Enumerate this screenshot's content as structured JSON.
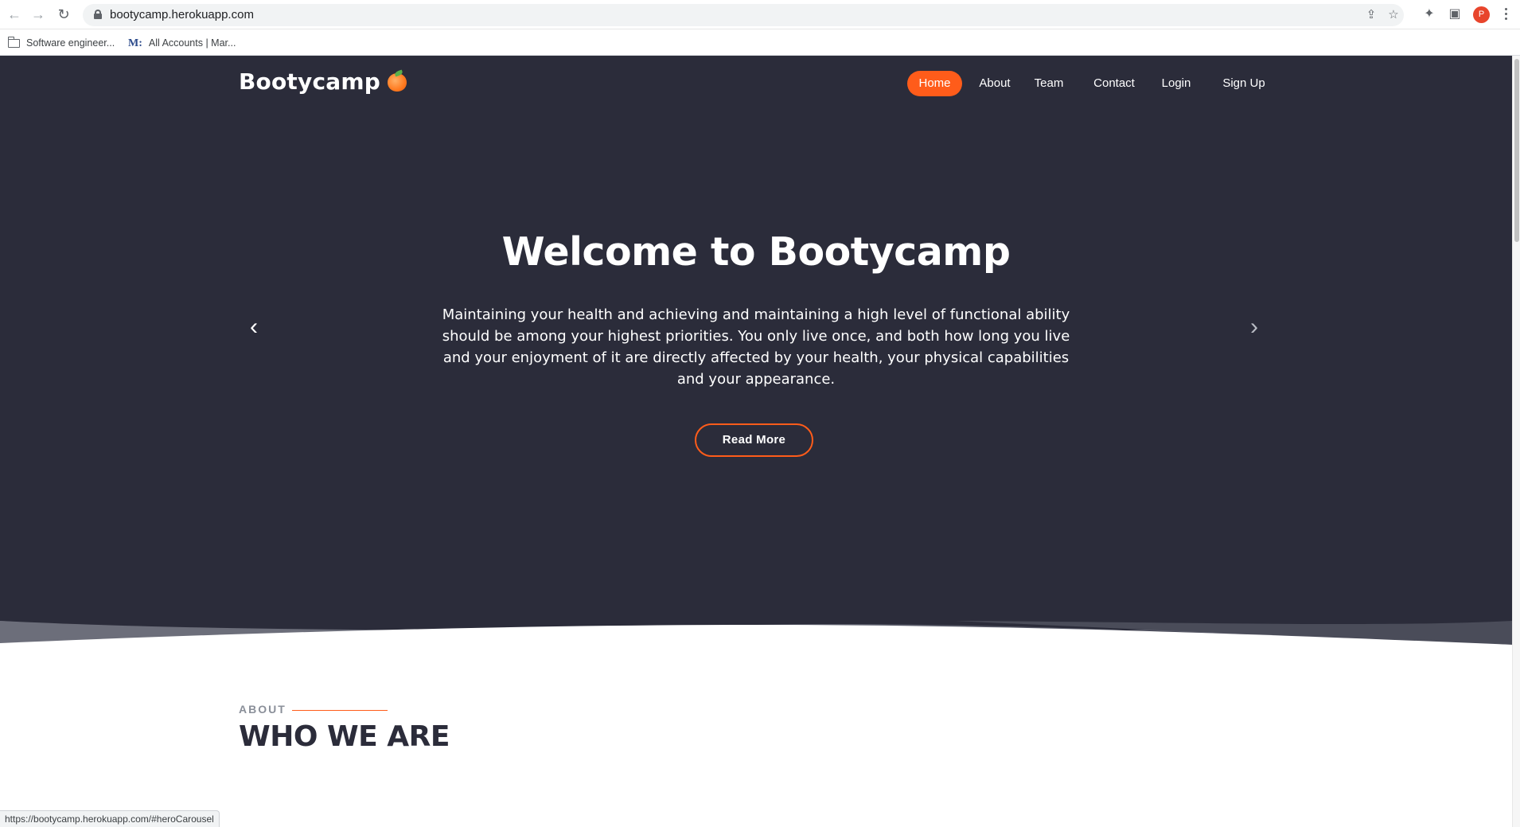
{
  "browser": {
    "url": "bootycamp.herokuapp.com",
    "avatar_letter": "P",
    "bookmarks": [
      {
        "label": "Software engineer...",
        "icon": "folder-icon"
      },
      {
        "label": "All Accounts | Mar...",
        "icon": "m-logo-icon"
      }
    ],
    "status_url": "https://bootycamp.herokuapp.com/#heroCarousel"
  },
  "site": {
    "logo_text": "Bootycamp",
    "logo_icon": "peach-icon",
    "nav": [
      {
        "label": "Home",
        "active": true
      },
      {
        "label": "About",
        "active": false
      },
      {
        "label": "Team",
        "active": false
      },
      {
        "label": "Contact",
        "active": false
      },
      {
        "label": "Login",
        "active": false
      },
      {
        "label": "Sign Up",
        "active": false
      }
    ]
  },
  "hero": {
    "title": "Welcome to Bootycamp",
    "text": "Maintaining your health and achieving and maintaining a high level of functional ability should be among your highest priorities. You only live once, and both how long you live and your enjoyment of it are directly affected by your health, your physical capabilities and your appearance.",
    "button_label": "Read More"
  },
  "about": {
    "label": "ABOUT",
    "title": "WHO WE ARE"
  },
  "colors": {
    "hero_bg": "#2b2c3a",
    "accent": "#ff5c1a"
  }
}
